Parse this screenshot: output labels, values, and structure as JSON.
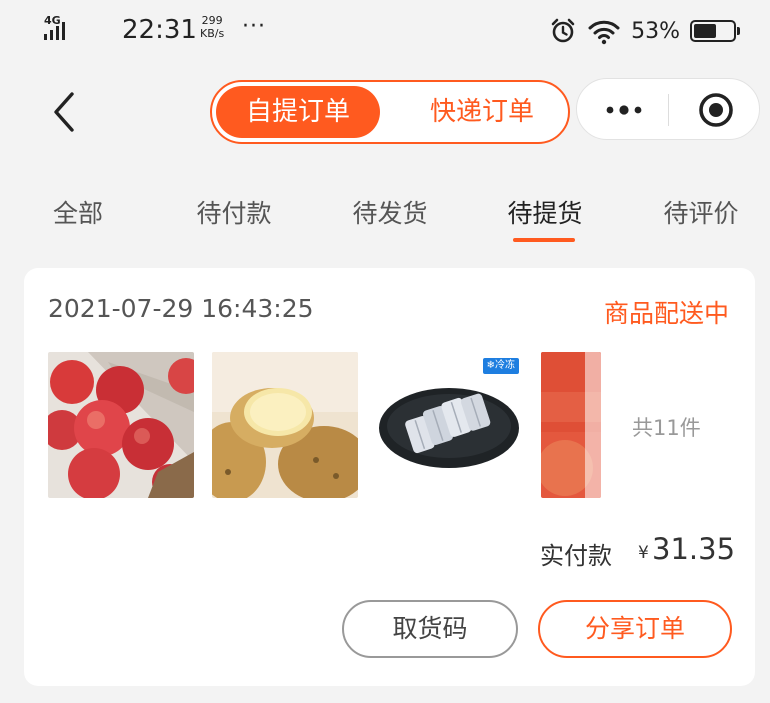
{
  "status_bar": {
    "network": "4G",
    "time": "22:31",
    "speed_value": "299",
    "speed_unit": "KB/s",
    "more_dots": "···",
    "battery_percent": "53%"
  },
  "nav": {
    "segment_active": "自提订单",
    "segment_other": "快递订单"
  },
  "tabs": [
    "全部",
    "待付款",
    "待发货",
    "待提货",
    "待评价"
  ],
  "active_tab": "待提货",
  "order": {
    "datetime": "2021-07-29 16:43:25",
    "status": "商品配送中",
    "products": [
      {
        "name": "apple",
        "icon": "apple-image"
      },
      {
        "name": "potato",
        "icon": "potato-image"
      },
      {
        "name": "frozen-fish",
        "icon": "fish-image",
        "badge": "❄冷冻"
      },
      {
        "name": "tomato",
        "icon": "tomato-image"
      }
    ],
    "item_count": "共11件",
    "paid_label": "实付款",
    "currency": "¥",
    "paid_amount": "31.35",
    "pickup_code_button": "取货码",
    "share_button": "分享订单"
  },
  "colors": {
    "accent": "#ff5a1f",
    "background": "#f3f3f3",
    "card": "#ffffff"
  }
}
